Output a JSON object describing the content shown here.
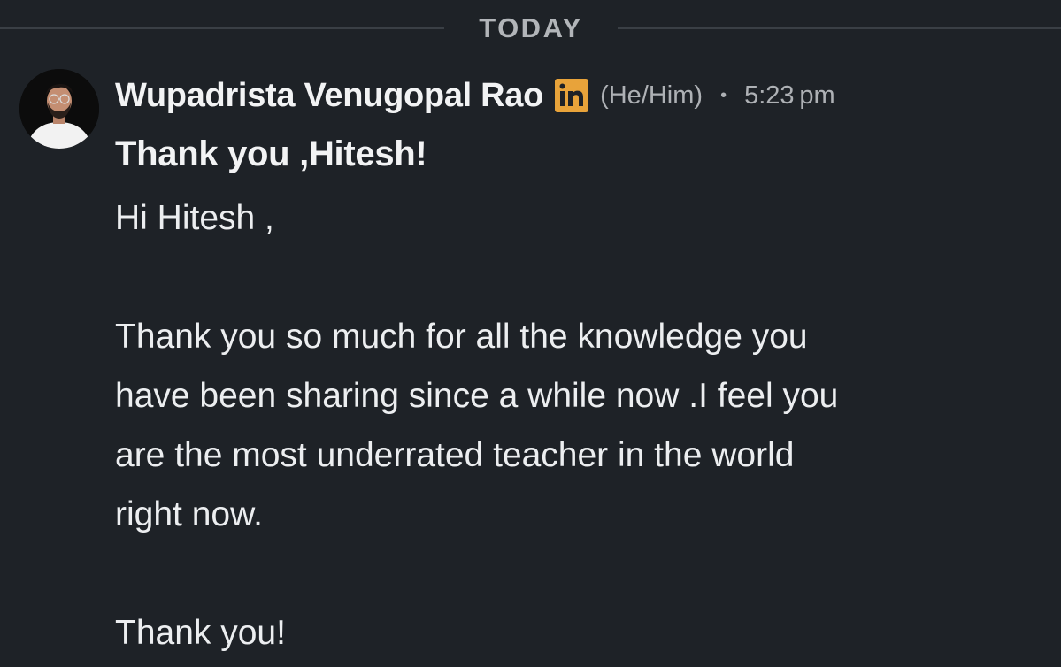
{
  "divider": {
    "label": "TODAY"
  },
  "message": {
    "sender": "Wupadrista Venugopal Rao",
    "badge_icon": "linkedin-icon",
    "badge_color": "#e8a33a",
    "pronouns": "(He/Him)",
    "separator": "•",
    "time": "5:23 pm",
    "subject": "Thank you ,Hitesh!",
    "greeting": "Hi Hitesh ,",
    "paragraph_lines": [
      "Thank you so much for all the knowledge you",
      "have been sharing since a while now .I feel you",
      "are the most underrated teacher in the world",
      "right now."
    ],
    "closing": "Thank you!"
  },
  "colors": {
    "background": "#1e2227",
    "text": "#eceef0",
    "muted": "#aeb1b5"
  }
}
